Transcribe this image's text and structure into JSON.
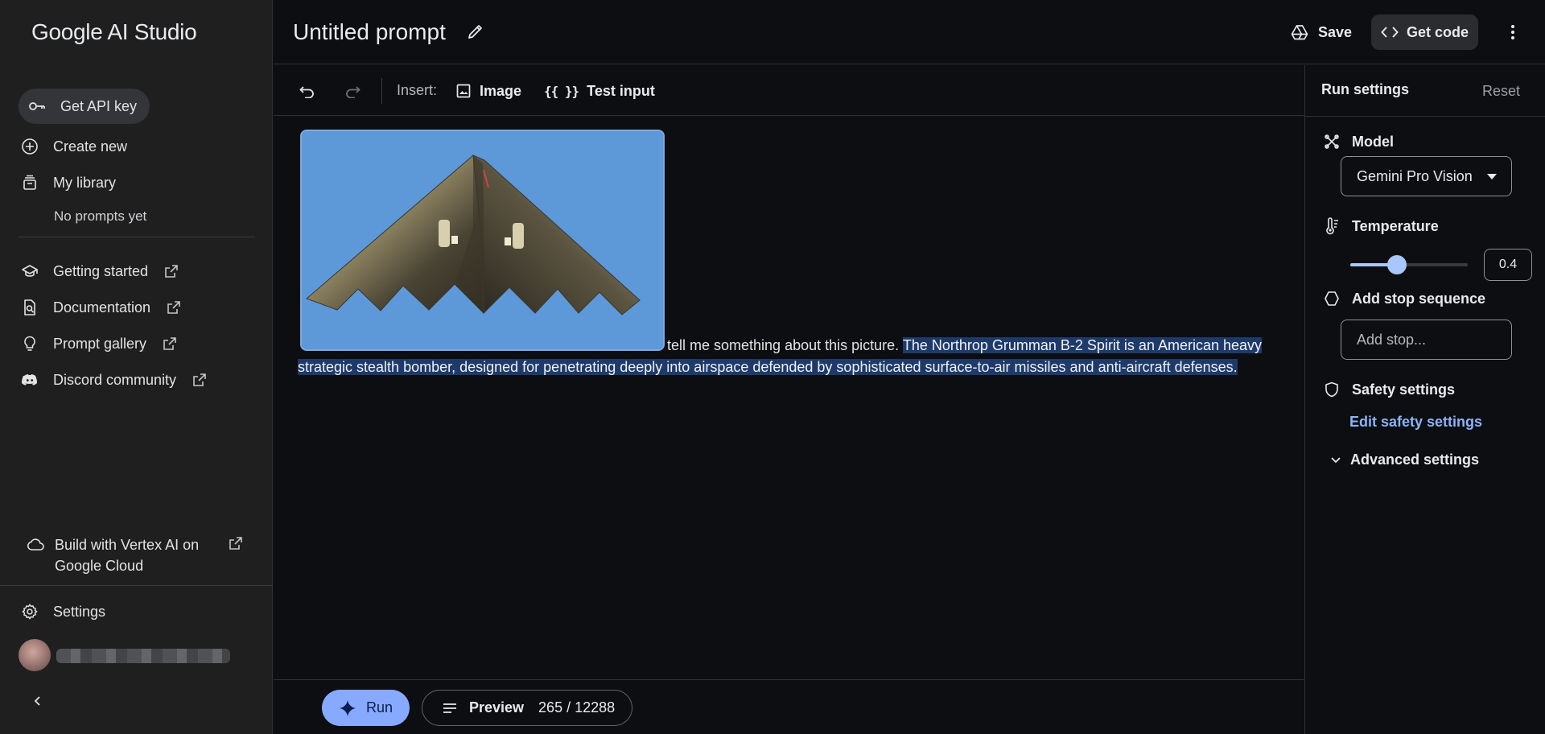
{
  "app": {
    "brand": "Google AI Studio"
  },
  "sidebar": {
    "get_api_key": "Get API key",
    "create_new": "Create new",
    "my_library": "My library",
    "no_prompts": "No prompts yet",
    "links": [
      {
        "label": "Getting started"
      },
      {
        "label": "Documentation"
      },
      {
        "label": "Prompt gallery"
      },
      {
        "label": "Discord community"
      }
    ],
    "vertex": "Build with Vertex AI on Google Cloud",
    "settings": "Settings"
  },
  "header": {
    "title": "Untitled prompt",
    "save": "Save",
    "get_code": "Get code"
  },
  "toolbar": {
    "insert_label": "Insert:",
    "image": "Image",
    "test_input_braces": "{{ }}",
    "test_input": "Test input"
  },
  "prompt": {
    "user_text": "tell me something about this picture.",
    "response_text": "The Northrop Grumman B-2 Spirit is an American heavy strategic stealth bomber, designed for penetrating deeply into airspace defended by sophisticated surface-to-air missiles and anti-aircraft defenses."
  },
  "bottom": {
    "run": "Run",
    "preview": "Preview",
    "token_count": "265 / 12288"
  },
  "run_settings": {
    "title": "Run settings",
    "reset": "Reset",
    "model_label": "Model",
    "model_value": "Gemini Pro Vision",
    "temperature_label": "Temperature",
    "temperature_value": "0.4",
    "temperature_fraction": 0.4,
    "stop_label": "Add stop sequence",
    "stop_placeholder": "Add stop...",
    "safety_label": "Safety settings",
    "safety_link": "Edit safety settings",
    "advanced_label": "Advanced settings"
  },
  "colors": {
    "accent": "#87a9ff",
    "link": "#8ab4f8",
    "highlight": "#1e3a6a",
    "sky": "#5d98d9"
  }
}
